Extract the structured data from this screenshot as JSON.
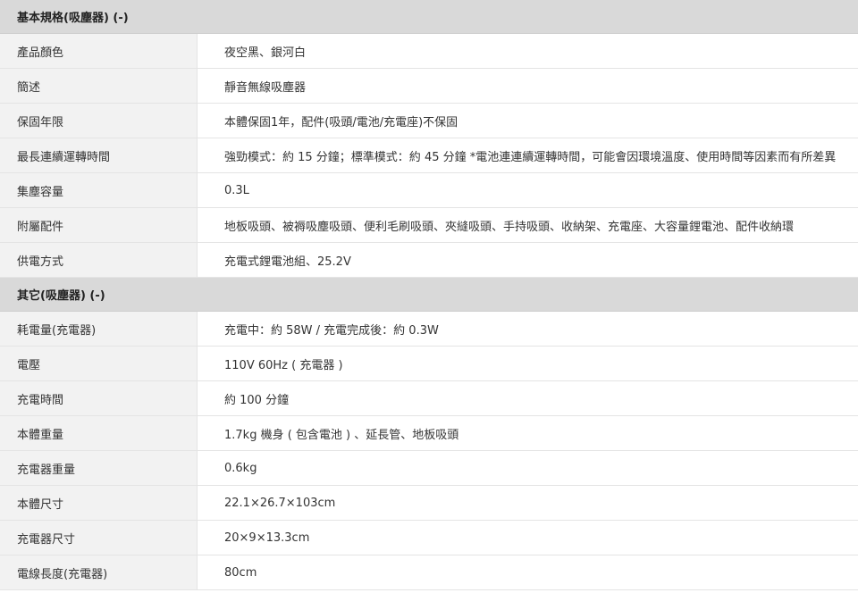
{
  "sections": [
    {
      "title": "基本規格(吸塵器) (-)",
      "rows": [
        {
          "label": "產品顏色",
          "value": "夜空黑、銀河白"
        },
        {
          "label": "簡述",
          "value": "靜音無線吸塵器"
        },
        {
          "label": "保固年限",
          "value": "本體保固1年，配件(吸頭/電池/充電座)不保固"
        },
        {
          "label": "最長連續運轉時間",
          "value": "強勁模式：約 15 分鐘；標準模式：約 45 分鐘 *電池連連續運轉時間，可能會因環境溫度、使用時間等因素而有所差異"
        },
        {
          "label": "集塵容量",
          "value": "0.3L"
        },
        {
          "label": "附屬配件",
          "value": "地板吸頭、被褥吸塵吸頭、便利毛刷吸頭、夾縫吸頭、手持吸頭、收納架、充電座、大容量鋰電池、配件收納環"
        },
        {
          "label": "供電方式",
          "value": "充電式鋰電池組、25.2V"
        }
      ]
    },
    {
      "title": "其它(吸塵器) (-)",
      "rows": [
        {
          "label": "耗電量(充電器)",
          "value": "充電中：約 58W / 充電完成後：約 0.3W"
        },
        {
          "label": "電壓",
          "value": "110V 60Hz ( 充電器 )"
        },
        {
          "label": "充電時間",
          "value": "約 100 分鐘"
        },
        {
          "label": "本體重量",
          "value": "1.7kg 機身 ( 包含電池 ) 、延長管、地板吸頭"
        },
        {
          "label": "充電器重量",
          "value": "0.6kg"
        },
        {
          "label": "本體尺寸",
          "value": "22.1×26.7×103cm"
        },
        {
          "label": "充電器尺寸",
          "value": "20×9×13.3cm"
        },
        {
          "label": "電線長度(充電器)",
          "value": "80cm"
        }
      ]
    }
  ]
}
